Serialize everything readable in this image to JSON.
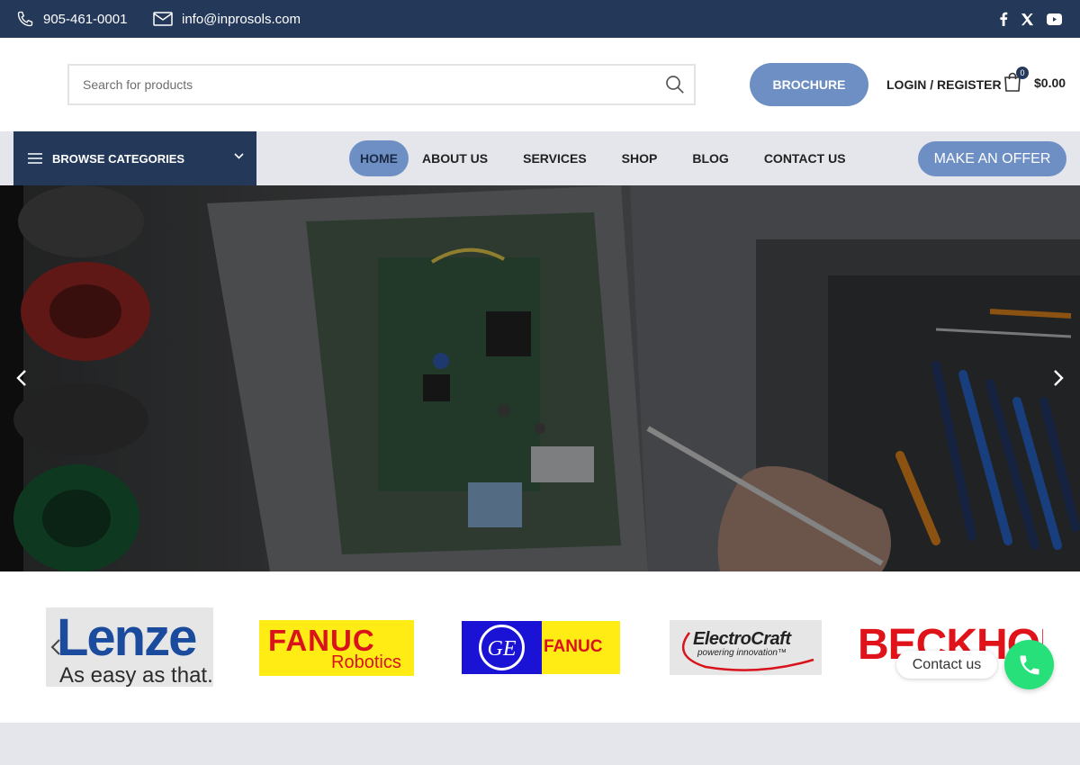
{
  "topbar": {
    "phone": "905-461-0001",
    "email": "info@inprosols.com",
    "socials": [
      {
        "icon": "facebook-icon",
        "glyph": "f"
      },
      {
        "icon": "x-twitter-icon",
        "glyph": "𝕏"
      },
      {
        "icon": "youtube-icon",
        "glyph": "▶"
      }
    ]
  },
  "header": {
    "search_placeholder": "Search for products",
    "brochure_label": "BROCHURE",
    "login_label": "LOGIN / REGISTER",
    "cart_count": "0",
    "cart_total": "$0.00"
  },
  "nav": {
    "browse_label": "BROWSE CATEGORIES",
    "items": [
      {
        "label": "HOME",
        "active": true
      },
      {
        "label": "ABOUT US",
        "active": false
      },
      {
        "label": "SERVICES",
        "active": false
      },
      {
        "label": "SHOP",
        "active": false
      },
      {
        "label": "BLOG",
        "active": false
      },
      {
        "label": "CONTACT US",
        "active": false
      }
    ],
    "offer_label": "MAKE AN OFFER"
  },
  "brands": {
    "lenze_name": "Lenze",
    "lenze_tagline": "As easy as that.",
    "fanuc_name": "FANUC",
    "fanuc_sub": "Robotics",
    "ge_logo": "GE",
    "ge_fanuc": "FANUC",
    "electrocraft_name": "ElectroCraft",
    "electrocraft_tag": "powering innovation™",
    "beckhoff_name": "BECKHOFF"
  },
  "chat": {
    "contact_label": "Contact us"
  },
  "colors": {
    "navy": "#24395a",
    "accent_blue": "#6d8fc4",
    "nav_bg": "#e5e5ec",
    "call_green": "#27e07a"
  }
}
